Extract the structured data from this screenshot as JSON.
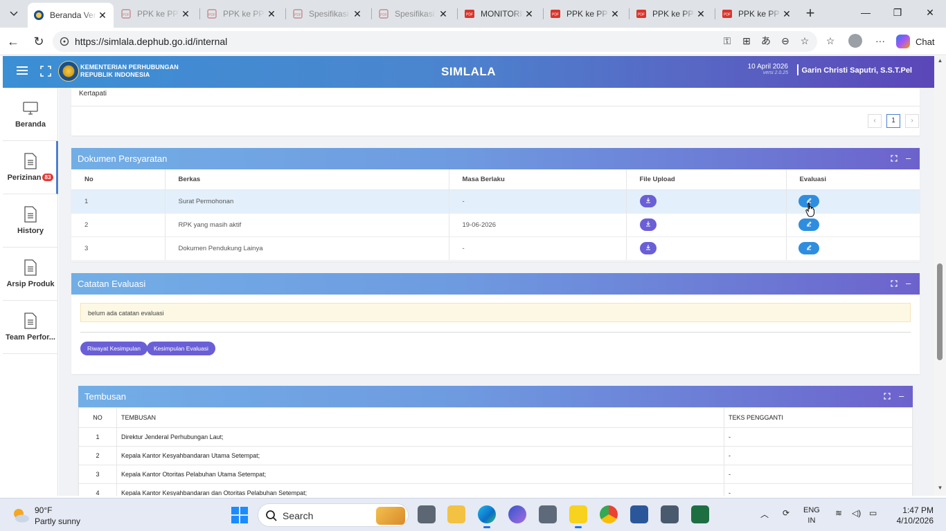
{
  "browser": {
    "tabs": [
      {
        "label": "Beranda Veri",
        "type": "site",
        "active": true
      },
      {
        "label": "PPK ke PP Pe",
        "type": "pdf-grey"
      },
      {
        "label": "PPK ke PP Pe",
        "type": "pdf-grey"
      },
      {
        "label": "Spesifikasi T",
        "type": "pdf-grey"
      },
      {
        "label": "Spesifikasi T",
        "type": "pdf-grey"
      },
      {
        "label": "MONITORIN",
        "type": "pdf-red"
      },
      {
        "label": "PPK ke PP Pe",
        "type": "pdf-red"
      },
      {
        "label": "PPK ke PP Pe",
        "type": "pdf-red"
      },
      {
        "label": "PPK ke PP Pe",
        "type": "pdf-red"
      }
    ],
    "url": "https://simlala.dephub.go.id/internal",
    "chat_label": "Chat"
  },
  "header": {
    "ministry_line1": "KEMENTERIAN PERHUBUNGAN",
    "ministry_line2": "REPUBLIK INDONESIA",
    "app_title": "SIMLALA",
    "date": "10 April 2026",
    "version": "versi 2.0.25",
    "user": "Garin Christi Saputri, S.S.T.Pel"
  },
  "sidebar": {
    "items": [
      {
        "label": "Beranda"
      },
      {
        "label": "Perizinan",
        "badge": "83"
      },
      {
        "label": "History"
      },
      {
        "label": "Arsip Produk"
      },
      {
        "label": "Team Perfor..."
      }
    ]
  },
  "top_card": {
    "text": "Kertapati",
    "pager": {
      "prev": "‹",
      "current": "1",
      "next": "›"
    }
  },
  "dokumen": {
    "title": "Dokumen Persyaratan",
    "columns": [
      "No",
      "Berkas",
      "Masa Berlaku",
      "File Upload",
      "Evaluasi"
    ],
    "rows": [
      {
        "no": "1",
        "berkas": "Surat Permohonan",
        "masa": "-"
      },
      {
        "no": "2",
        "berkas": "RPK yang masih aktif",
        "masa": "19-06-2026"
      },
      {
        "no": "3",
        "berkas": "Dokumen Pendukung Lainya",
        "masa": "-"
      }
    ]
  },
  "catatan": {
    "title": "Catatan Evaluasi",
    "note": "belum ada catatan evaluasi",
    "btn_riwayat": "Riwayat Kesimpulan",
    "btn_kesimpulan": "Kesimpulan Evaluasi"
  },
  "tembusan": {
    "title": "Tembusan",
    "columns": [
      "NO",
      "TEMBUSAN",
      "TEKS PENGGANTI"
    ],
    "rows": [
      {
        "no": "1",
        "tembusan": "Direktur Jenderal Perhubungan Laut;",
        "teks": "-"
      },
      {
        "no": "2",
        "tembusan": "Kepala Kantor Kesyahbandaran Utama Setempat;",
        "teks": "-"
      },
      {
        "no": "3",
        "tembusan": "Kepala Kantor Otoritas Pelabuhan Utama Setempat;",
        "teks": "-"
      },
      {
        "no": "4",
        "tembusan": "Kepala Kantor Kesyahbandaran dan Otoritas Pelabuhan Setempat;",
        "teks": "-"
      }
    ]
  },
  "taskbar": {
    "temp": "90°F",
    "condition": "Partly sunny",
    "search": "Search",
    "lang1": "ENG",
    "lang2": "IN",
    "time": "1:47 PM",
    "date": "4/10/2026"
  }
}
